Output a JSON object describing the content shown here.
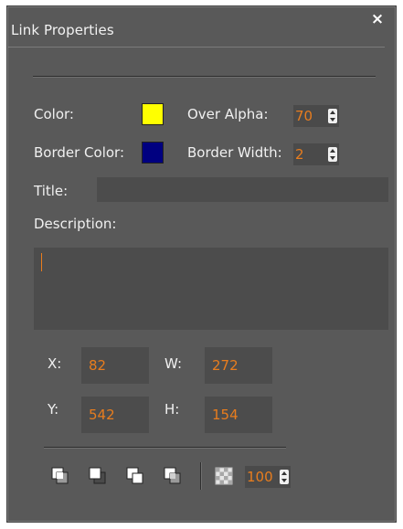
{
  "dialog": {
    "title": "Link Properties",
    "close_symbol": "×"
  },
  "appearance": {
    "color_label": "Color:",
    "color_value": "#FFFF00",
    "over_alpha_label": "Over Alpha:",
    "over_alpha_value": "70",
    "border_color_label": "Border Color:",
    "border_color_value": "#000080",
    "border_width_label": "Border Width:",
    "border_width_value": "2"
  },
  "fields": {
    "title_label": "Title:",
    "title_value": "",
    "description_label": "Description:",
    "description_value": ""
  },
  "geometry": {
    "x_label": "X:",
    "x_value": "82",
    "y_label": "Y:",
    "y_value": "542",
    "w_label": "W:",
    "w_value": "272",
    "h_label": "H:",
    "h_value": "154"
  },
  "toolbar": {
    "buttons": [
      "bring-to-front-icon",
      "send-to-back-icon",
      "bring-forward-icon",
      "send-backward-icon",
      "transparency-icon"
    ],
    "opacity_value": "100"
  },
  "colors": {
    "dialog_bg": "#595959",
    "field_bg": "#4c4c4c",
    "accent_value": "#E87D1E",
    "label_text": "#F0F0F0"
  }
}
